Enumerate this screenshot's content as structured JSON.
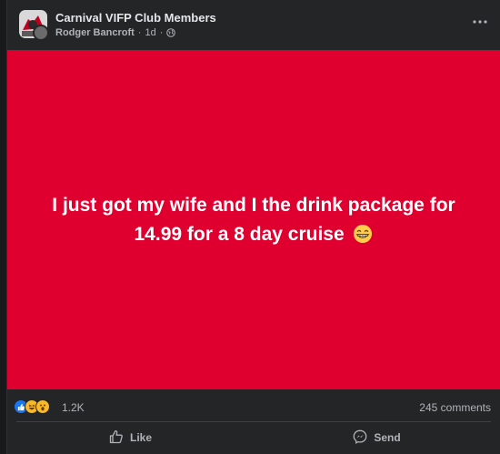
{
  "post": {
    "group_name": "Carnival VIFP Club Members",
    "author": "Rodger Bancroft",
    "time": "1d",
    "separator": "·",
    "body_line1": "I just got my wife and I the drink package for",
    "body_line2": "14.99 for a 8 day cruise",
    "background_color": "#e0002f"
  },
  "stats": {
    "reactions_count": "1.2K",
    "reactions": [
      "like-icon",
      "haha-icon",
      "wow-icon"
    ],
    "comments": "245 comments"
  },
  "actions": {
    "like_label": "Like",
    "send_label": "Send"
  },
  "colors": {
    "like_blue": "#1877f2",
    "haha_yellow": "#f7b928"
  }
}
